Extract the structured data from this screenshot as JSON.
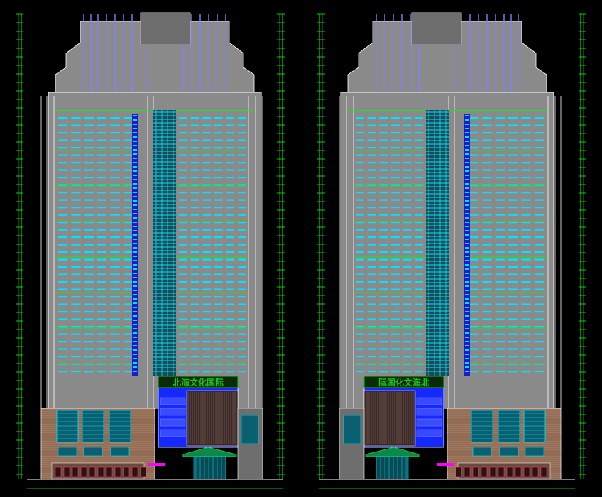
{
  "drawing": {
    "background": "#000000",
    "colors": {
      "facade": "#8a8a8a",
      "facade_dark": "#6e6e6e",
      "glass": "#00e5ff",
      "blue_panel": "#1428ff",
      "mullion_blue": "#1a1ad0",
      "dimension_green": "#00ff00",
      "band_green": "#20e020",
      "outline_white": "#ffffff",
      "brick": "#a07860",
      "brick_grid": "#5a3a2a",
      "sign_green": "#20c020",
      "magenta": "#ff00ff",
      "crown_purple": "#8080ff"
    },
    "elevations": [
      {
        "sign_text": "北海文化国际",
        "mirrored": false
      },
      {
        "sign_text": "际国化文海北",
        "mirrored": true
      }
    ]
  }
}
